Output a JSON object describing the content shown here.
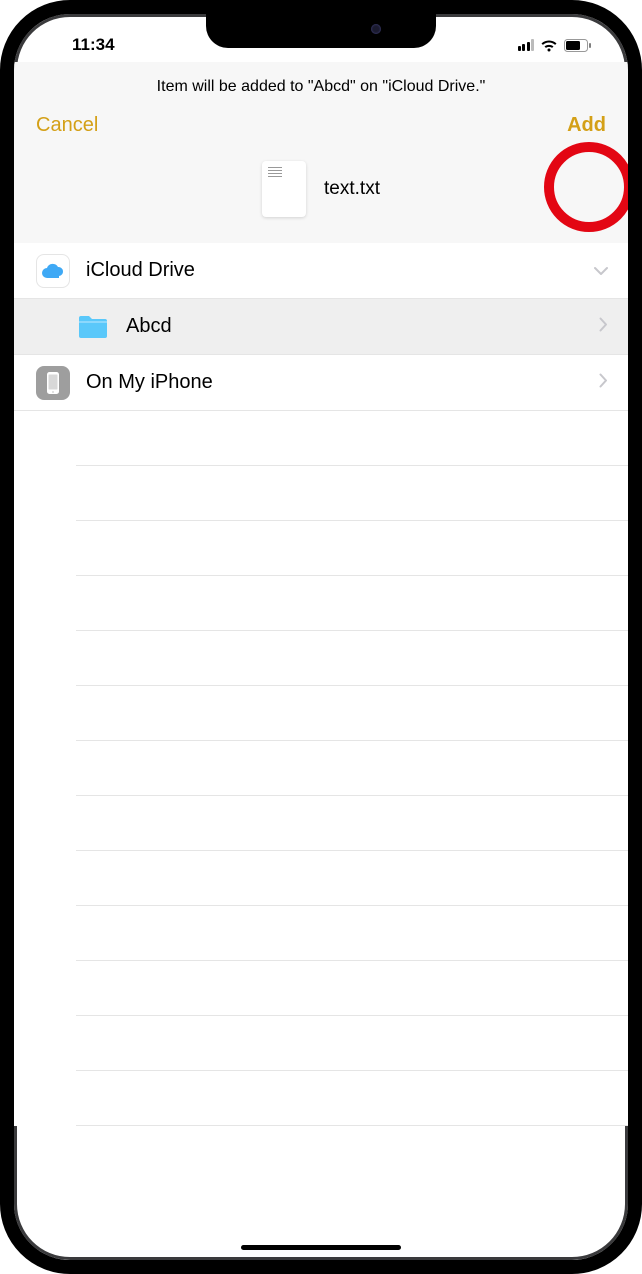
{
  "status_bar": {
    "time": "11:34"
  },
  "header": {
    "subtitle": "Item will be added to \"Abcd\" on \"iCloud Drive.\"",
    "cancel_label": "Cancel",
    "add_label": "Add"
  },
  "file": {
    "name": "text.txt"
  },
  "locations": [
    {
      "icon": "icloud-icon",
      "label": "iCloud Drive",
      "chevron": "down",
      "selected": false,
      "indented": false
    },
    {
      "icon": "folder-icon",
      "label": "Abcd",
      "chevron": "right",
      "selected": true,
      "indented": true
    },
    {
      "icon": "iphone-icon",
      "label": "On My iPhone",
      "chevron": "right",
      "selected": false,
      "indented": false
    }
  ],
  "annotation": {
    "highlight": "add-button"
  }
}
